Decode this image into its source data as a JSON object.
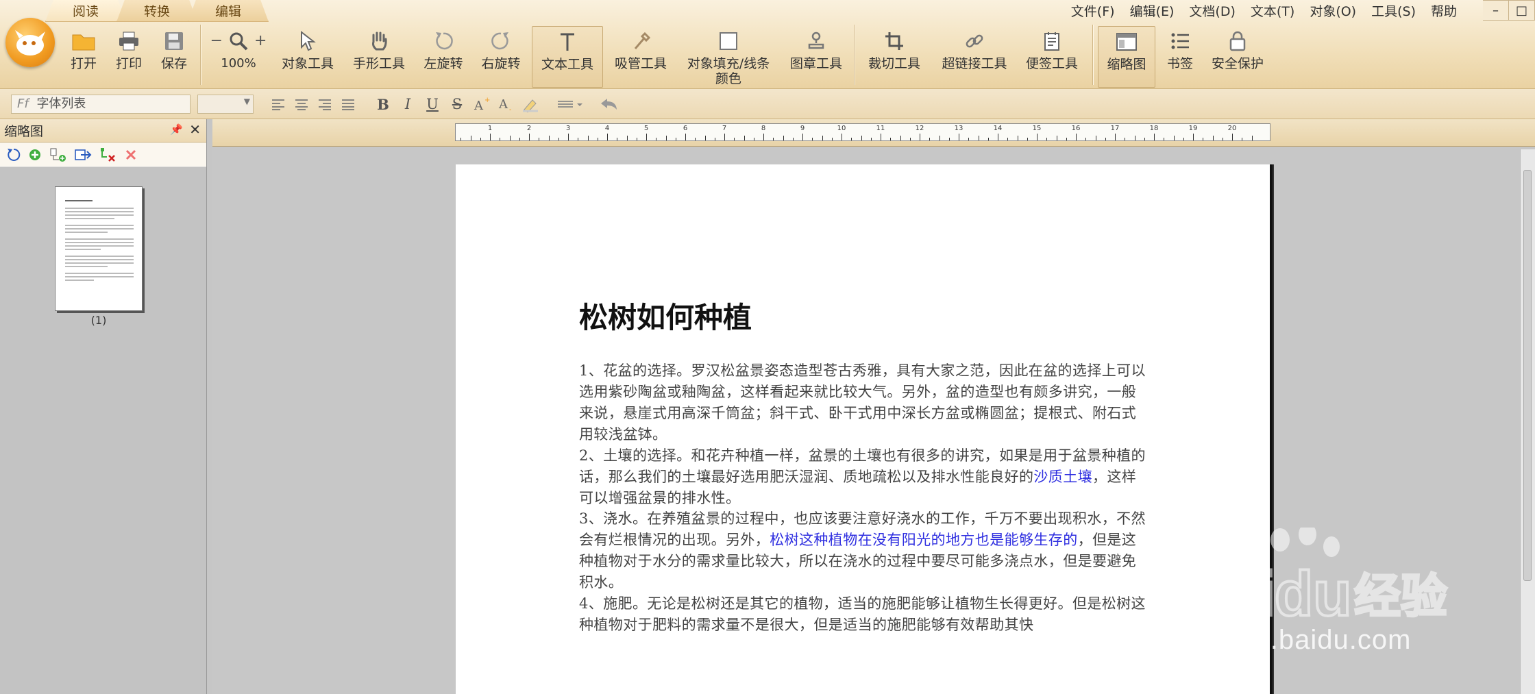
{
  "ribbon": {
    "tabs": [
      {
        "label": "阅读",
        "active": true
      },
      {
        "label": "转换",
        "active": false
      },
      {
        "label": "编辑",
        "active": false
      }
    ],
    "menu": [
      "文件(F)",
      "编辑(E)",
      "文档(D)",
      "文本(T)",
      "对象(O)",
      "工具(S)",
      "帮助"
    ],
    "window_controls": [
      "–",
      "□"
    ],
    "tools": {
      "open": "打开",
      "print": "打印",
      "save": "保存",
      "zoom_level": "100%",
      "zoom_minus": "−",
      "zoom_plus": "+",
      "object_tool": "对象工具",
      "hand_tool": "手形工具",
      "rotate_left": "左旋转",
      "rotate_right": "右旋转",
      "text_tool": "文本工具",
      "eyedropper_tool": "吸管工具",
      "fill_stroke_line1": "对象填充/线条",
      "fill_stroke_line2": "颜色",
      "stamp_tool": "图章工具",
      "crop_tool": "裁切工具",
      "hyperlink_tool": "超链接工具",
      "note_tool": "便签工具",
      "thumbnail": "缩略图",
      "bookmark": "书签",
      "security": "安全保护"
    },
    "active_tools": [
      "text_tool",
      "thumbnail"
    ]
  },
  "format_bar": {
    "font_list_placeholder": "字体列表",
    "font_size": "",
    "bold": "B",
    "italic": "I",
    "underline": "U",
    "strike": "S"
  },
  "left_panel": {
    "title": "缩略图",
    "page_label": "(1)"
  },
  "document": {
    "title": "松树如何种植",
    "paragraphs": {
      "p1": "1、花盆的选择。罗汉松盆景姿态造型苍古秀雅，具有大家之范，因此在盆的选择上可以选用紫砂陶盆或釉陶盆，这样看起来就比较大气。另外，盆的造型也有颇多讲究，一般来说，悬崖式用高深千筒盆；斜干式、卧干式用中深长方盆或椭圆盆；提根式、附石式用较浅盆钵。",
      "p2_a": "2、土壤的选择。和花卉种植一样，盆景的土壤也有很多的讲究，如果是用于盆景种植的话，那么我们的土壤最好选用肥沃湿润、质地疏松以及排水性能良好的",
      "p2_link": "沙质土壤",
      "p2_b": "，这样可以增强盆景的排水性。",
      "p3_a": "3、浇水。在养殖盆景的过程中，也应该要注意好浇水的工作，千万不要出现积水，不然会有烂根情况的出现。另外，",
      "p3_link": "松树这种植物在没有阳光的地方也是能够生存的",
      "p3_b": "，但是这种植物对于水分的需求量比较大，所以在浇水的过程中要尽可能多浇点水，但是要避免积水。",
      "p4": "4、施肥。无论是松树还是其它的植物，适当的施肥能够让植物生长得更好。但是松树这种植物对于肥料的需求量不是很大，但是适当的施肥能够有效帮助其快"
    },
    "link_color": "#2f2fe0"
  },
  "ruler": {
    "numbers": [
      "1",
      "2",
      "3",
      "4",
      "5",
      "6",
      "7",
      "8",
      "9",
      "10",
      "11",
      "12",
      "13",
      "14",
      "15",
      "16",
      "17",
      "18",
      "19",
      "20"
    ]
  },
  "watermark": {
    "brand": "Bai",
    "brand2": "du",
    "cn": "经验",
    "url": "jingyan.baidu.com"
  },
  "colors": {
    "ribbon_bg": "#f1dfb9",
    "accent_orange": "#f09a20",
    "link_blue": "#2f2fe0"
  }
}
